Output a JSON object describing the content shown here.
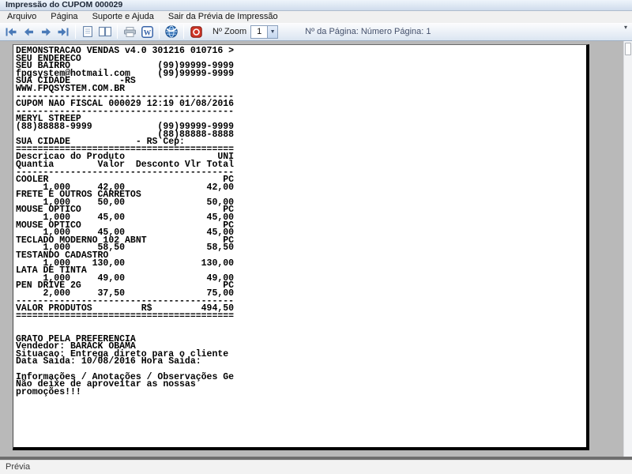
{
  "window": {
    "title": "Impressão do CUPOM 000029"
  },
  "menu": {
    "items": [
      "Arquivo",
      "Página",
      "Suporte e Ajuda",
      "Sair da Prévia de Impressão"
    ]
  },
  "toolbar": {
    "zoom_label": "Nº Zoom",
    "zoom_value": "1",
    "page_info": "Nº da Página: Número Página: 1",
    "word_letter": "W",
    "icons": [
      {
        "name": "first-page-icon",
        "glyph": "⏮"
      },
      {
        "name": "previous-page-icon",
        "glyph": "◀"
      },
      {
        "name": "next-page-icon",
        "glyph": "▶"
      },
      {
        "name": "last-page-icon",
        "glyph": "⏭"
      },
      {
        "name": "single-page-icon",
        "glyph": "▯"
      },
      {
        "name": "facing-pages-icon",
        "glyph": "▯▯"
      },
      {
        "name": "print-icon",
        "glyph": "⎙"
      },
      {
        "name": "word-export-icon",
        "glyph": "W"
      },
      {
        "name": "web-globe-icon",
        "glyph": "🌐"
      },
      {
        "name": "red-close-icon",
        "glyph": "⭙"
      }
    ]
  },
  "receipt": {
    "lines": [
      "DEMONSTRACAO VENDAS v4.0 301216 010716 >",
      "SEU ENDERECO",
      "SEU BAIRRO                (99)99999-9999",
      "fpqsystem@hotmail.com     (99)99999-9999",
      "SUA CIDADE         -RS",
      "WWW.FPQSYSTEM.COM.BR",
      "----------------------------------------",
      "CUPOM NAO FISCAL 000029 12:19 01/08/2016",
      "----------------------------------------",
      "MERYL STREEP",
      "(88)88888-9999            (99)99999-9999",
      "                          (88)88888-8888",
      "SUA CIDADE            - RS Cep:",
      "========================================",
      "Descricao do Produto                 UNI",
      "Quantia        Valor  Desconto Vlr Total",
      "----------------------------------------",
      "COOLER                                PC",
      "     1,000     42,00               42,00",
      "FRETE E OUTROS CARRETOS",
      "     1,000     50,00               50,00",
      "MOUSE OPTICO                          PC",
      "     1,000     45,00               45,00",
      "MOUSE OPTICO                          PC",
      "     1,000     45,00               45,00",
      "TECLADO MODERNO 102 ABNT              PC",
      "     1,000     58,50               58,50",
      "TESTANDO CADASTRO",
      "     1,000    130,00              130,00",
      "LATA DE TINTA",
      "     1,000     49,00               49,00",
      "PEN DRIVE 2G                          PC",
      "     2,000     37,50               75,00",
      "----------------------------------------",
      "VALOR PRODUTOS         R$         494,50",
      "========================================",
      "",
      "",
      "GRATO PELA PREFERENCIA",
      "Vendedor: BARACK OBAMA",
      "Situacao: Entrega direto para o cliente",
      "Data Saida: 10/08/2016 Hora Saida:",
      "",
      "Informações / Anotações / Observações Ge",
      "Não deixe de aproveitar as nossas",
      "promoções!!!"
    ]
  },
  "statusbar": {
    "text": "Prévia"
  },
  "colors": {
    "accent_blue": "#4a7ab8",
    "icon_red": "#cf3527",
    "preview_bg": "#b9b9b9",
    "page_shadow": "#000000"
  }
}
